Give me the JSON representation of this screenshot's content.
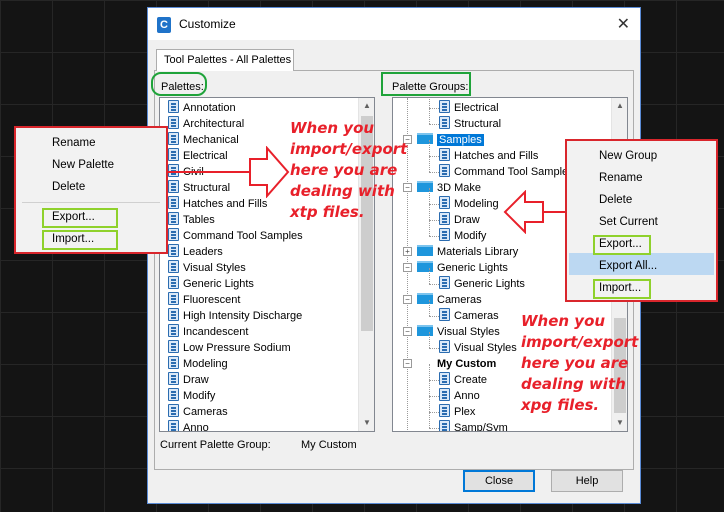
{
  "dialog": {
    "icon_letter": "C",
    "title": "Customize",
    "close_glyph": "✕",
    "tab_label": "Tool Palettes - All Palettes",
    "palettes_label": "Palettes:",
    "palette_groups_label": "Palette Groups:",
    "current_group_label": "Current Palette Group:",
    "current_group_value": "My Custom",
    "close_button": "Close",
    "help_button": "Help"
  },
  "palettes": [
    "Annotation",
    "Architectural",
    "Mechanical",
    "Electrical",
    "Civil",
    "Structural",
    "Hatches and Fills",
    "Tables",
    "Command Tool Samples",
    "Leaders",
    "Visual Styles",
    "Generic Lights",
    "Fluorescent",
    "High Intensity Discharge",
    "Incandescent",
    "Low Pressure Sodium",
    "Modeling",
    "Draw",
    "Modify",
    "Cameras",
    "Anno"
  ],
  "groups": [
    {
      "label": "Electrical",
      "level": 1,
      "type": "palette"
    },
    {
      "label": "Structural",
      "level": 1,
      "type": "palette"
    },
    {
      "label": "Samples",
      "level": 0,
      "type": "folder",
      "expanded": true,
      "selected": true
    },
    {
      "label": "Hatches and Fills",
      "level": 1,
      "type": "palette"
    },
    {
      "label": "Command Tool Samples",
      "level": 1,
      "type": "palette"
    },
    {
      "label": "3D Make",
      "level": 0,
      "type": "folder",
      "expanded": true
    },
    {
      "label": "Modeling",
      "level": 1,
      "type": "palette"
    },
    {
      "label": "Draw",
      "level": 1,
      "type": "palette"
    },
    {
      "label": "Modify",
      "level": 1,
      "type": "palette"
    },
    {
      "label": "Materials Library",
      "level": 0,
      "type": "folder"
    },
    {
      "label": "Generic Lights",
      "level": 0,
      "type": "folder",
      "expanded": true
    },
    {
      "label": "Generic Lights",
      "level": 1,
      "type": "palette"
    },
    {
      "label": "Cameras",
      "level": 0,
      "type": "folder",
      "expanded": true
    },
    {
      "label": "Cameras",
      "level": 1,
      "type": "palette"
    },
    {
      "label": "Visual Styles",
      "level": 0,
      "type": "folder",
      "expanded": true
    },
    {
      "label": "Visual Styles",
      "level": 1,
      "type": "palette"
    },
    {
      "label": "My Custom",
      "level": 0,
      "type": "none",
      "expanded": true,
      "bold": true
    },
    {
      "label": "Create",
      "level": 1,
      "type": "palette"
    },
    {
      "label": "Anno",
      "level": 1,
      "type": "palette"
    },
    {
      "label": "Plex",
      "level": 1,
      "type": "palette"
    },
    {
      "label": "Samp/Sym",
      "level": 1,
      "type": "palette"
    }
  ],
  "left_menu": {
    "items": [
      "Rename",
      "New Palette",
      "Delete",
      "Export...",
      "Import..."
    ]
  },
  "right_menu": {
    "items": [
      "New Group",
      "Rename",
      "Delete",
      "Set Current",
      "Export...",
      "Export All...",
      "Import..."
    ]
  },
  "annotations": {
    "left": [
      "When you",
      "import/export",
      "here you are",
      "dealing with",
      "xtp files."
    ],
    "right": [
      "When you",
      "import/export",
      "here you are",
      "dealing with",
      "xpg files."
    ]
  },
  "colors": {
    "annotation_red": "#e8202a",
    "highlight_green": "#8fd12c",
    "label_green": "#1fa33a",
    "selection_blue": "#0078d7"
  }
}
